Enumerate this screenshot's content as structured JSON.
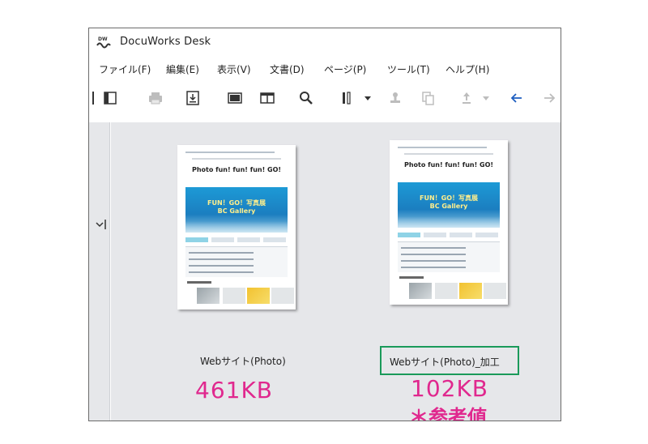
{
  "window": {
    "title": "DocuWorks Desk"
  },
  "menu": [
    {
      "label": "ファイル(F)"
    },
    {
      "label": "編集(E)"
    },
    {
      "label": "表示(V)"
    },
    {
      "label": "文書(D)"
    },
    {
      "label": "ページ(P)"
    },
    {
      "label": "ツール(T)"
    },
    {
      "label": "ヘルプ(H)"
    }
  ],
  "toolbar_icons": [
    "panel-icon",
    "print-icon",
    "download-icon",
    "view-single-icon",
    "view-double-icon",
    "search-icon",
    "bind-icon",
    "dropdown-arrow-icon",
    "stamp-icon",
    "copy-icon",
    "upload-icon",
    "dropdown-arrow-icon",
    "back-arrow-icon",
    "forward-arrow-icon"
  ],
  "documents": [
    {
      "thumbnail_title": "Photo fun! fun! fun! GO!",
      "banner_sub": "FUN！GO！写真展",
      "banner_sub2": "BC Gallery",
      "name": "Webサイト(Photo)",
      "size": "461KB",
      "note": ""
    },
    {
      "thumbnail_title": "Photo fun! fun! fun! GO!",
      "banner_sub": "FUN！GO！写真展",
      "banner_sub2": "BC Gallery",
      "name": "Webサイト(Photo)_加工",
      "size": "102KB",
      "note": "＊参考値"
    }
  ],
  "colors": {
    "accent": "#e0288e",
    "selection": "#1a9a5a",
    "background": "#e6e7ea"
  }
}
